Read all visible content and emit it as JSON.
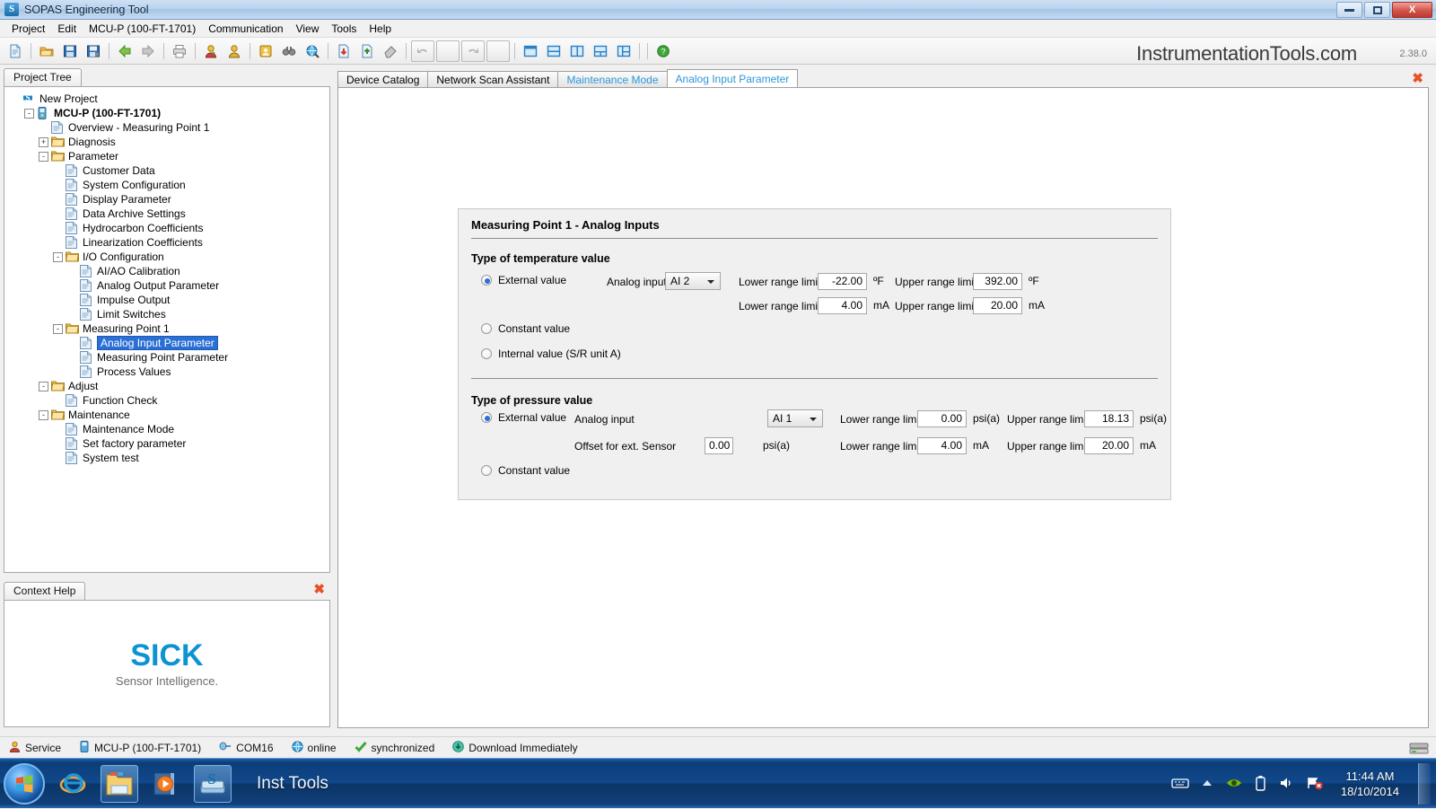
{
  "window": {
    "title": "SOPAS Engineering Tool",
    "app_icon": "sick-logo-icon",
    "minimize_label": "Minimize",
    "maximize_label": "Maximize",
    "close_label": "X"
  },
  "menubar": {
    "items": [
      {
        "label": "Project",
        "name": "menu-project"
      },
      {
        "label": "Edit",
        "name": "menu-edit"
      },
      {
        "label": "MCU-P (100-FT-1701)",
        "name": "menu-device"
      },
      {
        "label": "Communication",
        "name": "menu-communication"
      },
      {
        "label": "View",
        "name": "menu-view"
      },
      {
        "label": "Tools",
        "name": "menu-tools"
      },
      {
        "label": "Help",
        "name": "menu-help"
      }
    ]
  },
  "toolbar": {
    "brand": "InstrumentationTools.com",
    "version": "2.38.0",
    "buttons": [
      "new-document-icon",
      "open-folder-icon",
      "save-icon",
      "save-as-icon",
      "back-arrow-icon",
      "forward-arrow-icon",
      "print-icon",
      "user-login-icon",
      "user-switch-icon",
      "address-book-icon",
      "binoculars-icon",
      "globe-search-icon",
      "download-icon",
      "upload-icon",
      "eraser-icon",
      "undo-icon",
      "redo-icon",
      "layout-single-icon",
      "layout-horizontal-split-icon",
      "layout-vertical-split-icon",
      "layout-three-pane-icon",
      "layout-mixed-icon",
      "help-icon"
    ]
  },
  "left_panel": {
    "tab_label": "Project Tree",
    "tree": [
      {
        "label": "New Project",
        "depth": 0,
        "icon": "sick-logo-icon",
        "expander": "",
        "bold": false,
        "selected": false
      },
      {
        "label": "MCU-P (100-FT-1701)",
        "depth": 1,
        "icon": "device-icon",
        "expander": "-",
        "bold": true,
        "selected": false
      },
      {
        "label": "Overview - Measuring Point 1",
        "depth": 2,
        "icon": "page-icon",
        "expander": "",
        "bold": false,
        "selected": false
      },
      {
        "label": "Diagnosis",
        "depth": 2,
        "icon": "folder-icon",
        "expander": "+",
        "bold": false,
        "selected": false
      },
      {
        "label": "Parameter",
        "depth": 2,
        "icon": "folder-icon",
        "expander": "-",
        "bold": false,
        "selected": false
      },
      {
        "label": "Customer Data",
        "depth": 3,
        "icon": "page-icon",
        "expander": "",
        "bold": false,
        "selected": false
      },
      {
        "label": "System Configuration",
        "depth": 3,
        "icon": "page-icon",
        "expander": "",
        "bold": false,
        "selected": false
      },
      {
        "label": "Display Parameter",
        "depth": 3,
        "icon": "page-icon",
        "expander": "",
        "bold": false,
        "selected": false
      },
      {
        "label": "Data Archive Settings",
        "depth": 3,
        "icon": "page-icon",
        "expander": "",
        "bold": false,
        "selected": false
      },
      {
        "label": "Hydrocarbon Coefficients",
        "depth": 3,
        "icon": "page-icon",
        "expander": "",
        "bold": false,
        "selected": false
      },
      {
        "label": "Linearization Coefficients",
        "depth": 3,
        "icon": "page-icon",
        "expander": "",
        "bold": false,
        "selected": false
      },
      {
        "label": "I/O Configuration",
        "depth": 3,
        "icon": "folder-icon",
        "expander": "-",
        "bold": false,
        "selected": false
      },
      {
        "label": "AI/AO Calibration",
        "depth": 4,
        "icon": "page-icon",
        "expander": "",
        "bold": false,
        "selected": false
      },
      {
        "label": "Analog Output Parameter",
        "depth": 4,
        "icon": "page-icon",
        "expander": "",
        "bold": false,
        "selected": false
      },
      {
        "label": "Impulse Output",
        "depth": 4,
        "icon": "page-icon",
        "expander": "",
        "bold": false,
        "selected": false
      },
      {
        "label": "Limit Switches",
        "depth": 4,
        "icon": "page-icon",
        "expander": "",
        "bold": false,
        "selected": false
      },
      {
        "label": "Measuring Point 1",
        "depth": 3,
        "icon": "folder-icon",
        "expander": "-",
        "bold": false,
        "selected": false
      },
      {
        "label": "Analog Input Parameter",
        "depth": 4,
        "icon": "page-icon",
        "expander": "",
        "bold": false,
        "selected": true
      },
      {
        "label": "Measuring Point Parameter",
        "depth": 4,
        "icon": "page-icon",
        "expander": "",
        "bold": false,
        "selected": false
      },
      {
        "label": "Process Values",
        "depth": 4,
        "icon": "page-icon",
        "expander": "",
        "bold": false,
        "selected": false
      },
      {
        "label": "Adjust",
        "depth": 2,
        "icon": "folder-icon",
        "expander": "-",
        "bold": false,
        "selected": false
      },
      {
        "label": "Function Check",
        "depth": 3,
        "icon": "page-icon",
        "expander": "",
        "bold": false,
        "selected": false
      },
      {
        "label": "Maintenance",
        "depth": 2,
        "icon": "folder-icon",
        "expander": "-",
        "bold": false,
        "selected": false
      },
      {
        "label": "Maintenance Mode",
        "depth": 3,
        "icon": "page-icon",
        "expander": "",
        "bold": false,
        "selected": false
      },
      {
        "label": "Set factory parameter",
        "depth": 3,
        "icon": "page-icon",
        "expander": "",
        "bold": false,
        "selected": false
      },
      {
        "label": "System test",
        "depth": 3,
        "icon": "page-icon",
        "expander": "",
        "bold": false,
        "selected": false
      }
    ]
  },
  "help_panel": {
    "tab_label": "Context Help",
    "close_label": "✖",
    "logo_text": "SICK",
    "tagline": "Sensor Intelligence.",
    "logo_color": "#0e93d2"
  },
  "main": {
    "tabs": [
      {
        "label": "Device Catalog",
        "name": "tab-device-catalog",
        "style": "normal",
        "active": false
      },
      {
        "label": "Network Scan Assistant",
        "name": "tab-network-scan-assistant",
        "style": "normal",
        "active": false
      },
      {
        "label": "Maintenance Mode",
        "name": "tab-maintenance-mode",
        "style": "link",
        "active": false
      },
      {
        "label": "Analog Input Parameter",
        "name": "tab-analog-input-parameter",
        "style": "link",
        "active": true
      }
    ],
    "close_label": "✖"
  },
  "card": {
    "title": "Measuring Point 1 - Analog Inputs",
    "temperature": {
      "section_title": "Type of temperature value",
      "option_external": "External value",
      "option_constant": "Constant value",
      "option_internal": "Internal value (S/R unit A)",
      "selected": "external",
      "analog_input_label": "Analog input",
      "analog_input_value": "AI 2",
      "lower_label": "Lower range limit",
      "upper_label": "Upper range limit",
      "lower_eng_value": "-22.00",
      "lower_eng_unit": "ºF",
      "upper_eng_value": "392.00",
      "upper_eng_unit": "ºF",
      "lower_ma_value": "4.00",
      "lower_ma_unit": "mA",
      "upper_ma_value": "20.00",
      "upper_ma_unit": "mA"
    },
    "pressure": {
      "section_title": "Type of pressure value",
      "option_external": "External value",
      "option_constant": "Constant value",
      "selected": "external",
      "analog_input_label": "Analog input",
      "analog_input_value": "AI 1",
      "offset_label": "Offset for ext. Sensor",
      "offset_value": "0.00",
      "offset_unit": "psi(a)",
      "lower_label": "Lower range limit",
      "upper_label": "Upper range limit",
      "lower_eng_value": "0.00",
      "lower_eng_unit": "psi(a)",
      "upper_eng_value": "18.13",
      "upper_eng_unit": "psi(a)",
      "lower_ma_value": "4.00",
      "lower_ma_unit": "mA",
      "upper_ma_value": "20.00",
      "upper_ma_unit": "mA"
    }
  },
  "statusbar": {
    "items": [
      {
        "label": "Service",
        "icon": "user-icon"
      },
      {
        "label": "MCU-P (100-FT-1701)",
        "icon": "device-icon"
      },
      {
        "label": "COM16",
        "icon": "port-icon"
      },
      {
        "label": "online",
        "icon": "globe-icon"
      },
      {
        "label": "synchronized",
        "icon": "check-icon"
      },
      {
        "label": "Download Immediately",
        "icon": "download-icon"
      }
    ]
  },
  "taskbar": {
    "start_label": "Start",
    "items": [
      {
        "name": "taskbar-internet-explorer",
        "icon": "internet-explorer-icon",
        "pressed": false
      },
      {
        "name": "taskbar-file-explorer",
        "icon": "folder-icon",
        "pressed": true
      },
      {
        "name": "taskbar-media-player",
        "icon": "media-player-icon",
        "pressed": false
      },
      {
        "name": "taskbar-sopas",
        "icon": "sopas-icon",
        "pressed": true
      }
    ],
    "active_window": "Inst Tools",
    "tray": [
      "keyboard-icon",
      "show-hidden-icons-icon",
      "nvidia-icon",
      "battery-icon",
      "volume-icon",
      "network-error-icon"
    ],
    "time": "11:44 AM",
    "date": "18/10/2014"
  }
}
